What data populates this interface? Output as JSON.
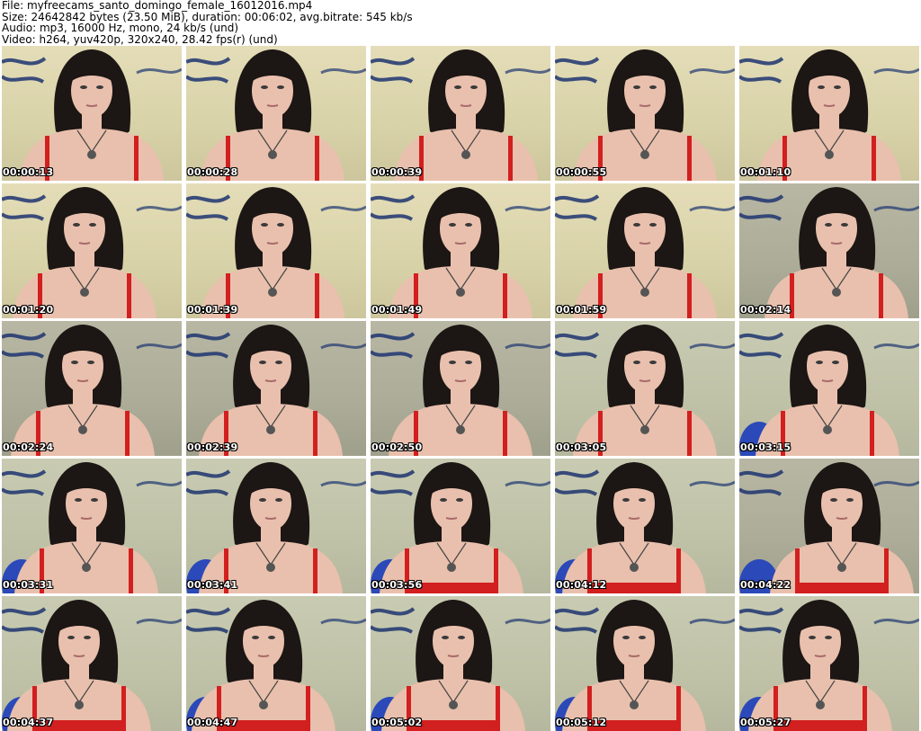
{
  "header": {
    "file_line": "File: myfreecams_santo_domingo_female_16012016.mp4",
    "size_line": "Size: 24642842 bytes (23.50 MiB), duration: 00:06:02, avg.bitrate: 545 kb/s",
    "audio_line": "Audio: mp3, 16000 Hz, mono, 24 kb/s (und)",
    "video_line": "Video: h264, yuv420p, 320x240, 28.42 fps(r) (und)"
  },
  "thumbnails": [
    {
      "timestamp": "00:00:13"
    },
    {
      "timestamp": "00:00:28"
    },
    {
      "timestamp": "00:00:39"
    },
    {
      "timestamp": "00:00:55"
    },
    {
      "timestamp": "00:01:10"
    },
    {
      "timestamp": "00:01:20"
    },
    {
      "timestamp": "00:01:39"
    },
    {
      "timestamp": "00:01:49"
    },
    {
      "timestamp": "00:01:59"
    },
    {
      "timestamp": "00:02:14"
    },
    {
      "timestamp": "00:02:24"
    },
    {
      "timestamp": "00:02:39"
    },
    {
      "timestamp": "00:02:50"
    },
    {
      "timestamp": "00:03:05"
    },
    {
      "timestamp": "00:03:15"
    },
    {
      "timestamp": "00:03:31"
    },
    {
      "timestamp": "00:03:41"
    },
    {
      "timestamp": "00:03:56"
    },
    {
      "timestamp": "00:04:12"
    },
    {
      "timestamp": "00:04:22"
    },
    {
      "timestamp": "00:04:37"
    },
    {
      "timestamp": "00:04:47"
    },
    {
      "timestamp": "00:05:02"
    },
    {
      "timestamp": "00:05:12"
    },
    {
      "timestamp": "00:05:27"
    }
  ],
  "colors": {
    "hair": "#1c1614",
    "skin": "#e9c0ad",
    "top": "#d21f1f",
    "garland": "#1d3470",
    "chair": "#2b49b8",
    "timestamp_text": "#ffffff"
  }
}
